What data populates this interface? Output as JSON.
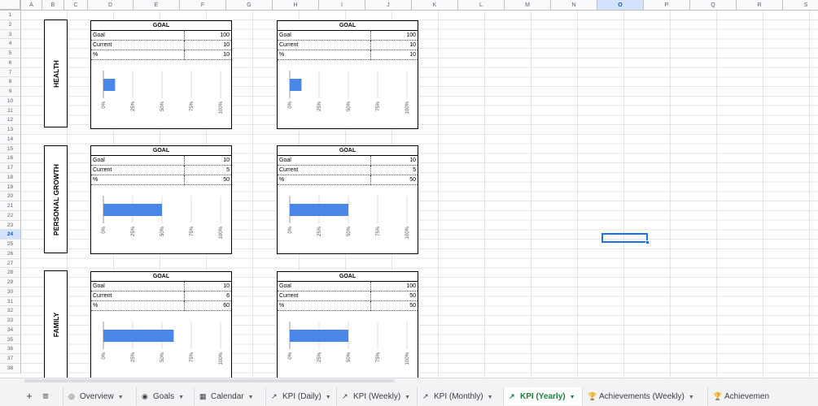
{
  "columns": [
    "A",
    "B",
    "C",
    "D",
    "E",
    "F",
    "G",
    "H",
    "I",
    "J",
    "K",
    "L",
    "M",
    "N",
    "O",
    "P",
    "Q",
    "R",
    "S"
  ],
  "rows": [
    "1",
    "2",
    "3",
    "4",
    "5",
    "6",
    "7",
    "8",
    "9",
    "10",
    "11",
    "12",
    "13",
    "14",
    "15",
    "16",
    "17",
    "18",
    "19",
    "20",
    "21",
    "22",
    "23",
    "24",
    "25",
    "26",
    "27",
    "28",
    "29",
    "30",
    "31",
    "32",
    "33",
    "34",
    "35",
    "36",
    "37",
    "38"
  ],
  "selected": {
    "column": "O",
    "row": "24"
  },
  "categories": [
    {
      "label": "HEALTH"
    },
    {
      "label": "PERSONAL GROWTH"
    },
    {
      "label": "FAMILY"
    }
  ],
  "cards": [
    {
      "title": "GOAL",
      "rows": [
        {
          "label": "Goal",
          "value": "100"
        },
        {
          "label": "Current",
          "value": "10"
        },
        {
          "label": "%",
          "value": "10"
        }
      ],
      "percent": 10
    },
    {
      "title": "GOAL",
      "rows": [
        {
          "label": "Goal",
          "value": "100"
        },
        {
          "label": "Current",
          "value": "10"
        },
        {
          "label": "%",
          "value": "10"
        }
      ],
      "percent": 10
    },
    {
      "title": "GOAL",
      "rows": [
        {
          "label": "Goal",
          "value": "10"
        },
        {
          "label": "Current",
          "value": "5"
        },
        {
          "label": "%",
          "value": "50"
        }
      ],
      "percent": 50
    },
    {
      "title": "GOAL",
      "rows": [
        {
          "label": "Goal",
          "value": "10"
        },
        {
          "label": "Current",
          "value": "5"
        },
        {
          "label": "%",
          "value": "50"
        }
      ],
      "percent": 50
    },
    {
      "title": "GOAL",
      "rows": [
        {
          "label": "Goal",
          "value": "10"
        },
        {
          "label": "Current",
          "value": "6"
        },
        {
          "label": "%",
          "value": "60"
        }
      ],
      "percent": 60
    },
    {
      "title": "GOAL",
      "rows": [
        {
          "label": "Goal",
          "value": "100"
        },
        {
          "label": "Current",
          "value": "50"
        },
        {
          "label": "%",
          "value": "50"
        }
      ],
      "percent": 50
    }
  ],
  "chart": {
    "ticks": [
      "0%",
      "25%",
      "50%",
      "75%",
      "100%"
    ],
    "bar_color": "#4a86e8",
    "xlim": [
      0,
      100
    ]
  },
  "tabs": [
    {
      "label": "Overview",
      "icon": "compass-icon",
      "glyph": "◎",
      "active": false
    },
    {
      "label": "Goals",
      "icon": "target-icon",
      "glyph": "◉",
      "active": false
    },
    {
      "label": "Calendar",
      "icon": "calendar-icon",
      "glyph": "▦",
      "active": false
    },
    {
      "label": "KPI (Daily)",
      "icon": "chart-icon",
      "glyph": "↗",
      "active": false
    },
    {
      "label": "KPI (Weekly)",
      "icon": "chart-icon",
      "glyph": "↗",
      "active": false
    },
    {
      "label": "KPI (Monthly)",
      "icon": "chart-icon",
      "glyph": "↗",
      "active": false
    },
    {
      "label": "KPI (Yearly)",
      "icon": "chart-icon",
      "glyph": "↗",
      "active": true
    },
    {
      "label": "Achievements (Weekly)",
      "icon": "trophy-icon",
      "glyph": "🏆",
      "active": false
    },
    {
      "label": "Achievemen",
      "icon": "trophy-icon",
      "glyph": "🏆",
      "active": false
    }
  ],
  "toolbar": {
    "add_sheet": "+",
    "all_sheets": "≡"
  }
}
